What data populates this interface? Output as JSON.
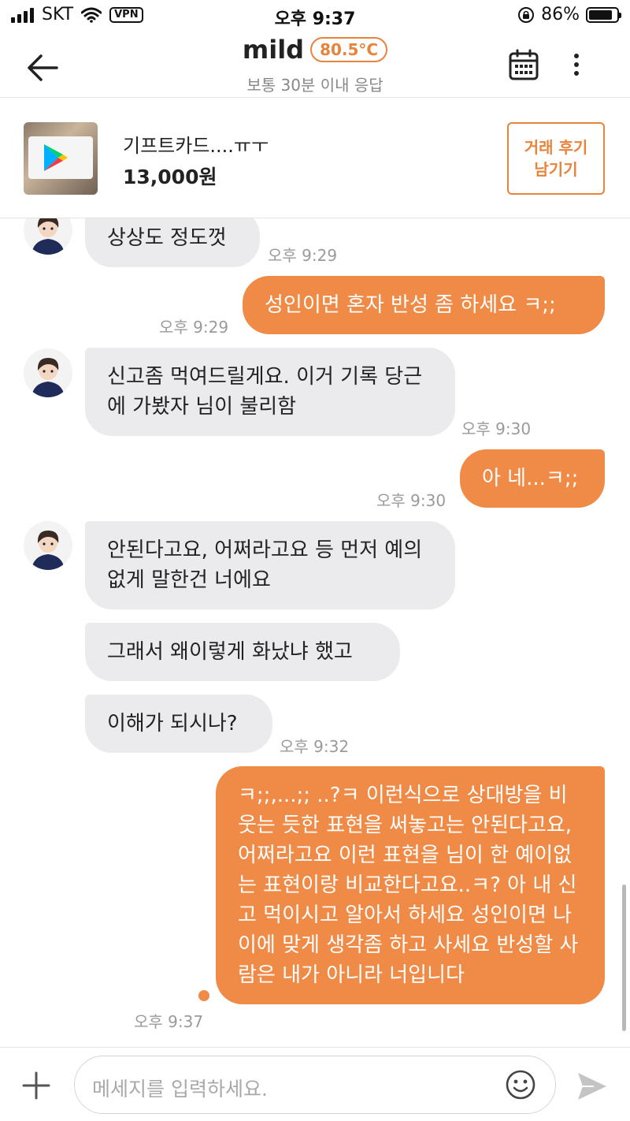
{
  "status_bar": {
    "carrier": "SKT",
    "vpn": "VPN",
    "time": "오후 9:37",
    "battery": "86%",
    "battery_level": 0.86
  },
  "header": {
    "user_name": "mild",
    "manner_temperature": "80.5°C",
    "response_time": "보통 30분 이내 응답",
    "icons": [
      "back-arrow-icon",
      "calendar-icon",
      "more-vertical-icon"
    ]
  },
  "product": {
    "title": "기프트카드....ㅠㅜ",
    "price": "13,000원",
    "review_button": "거래 후기 남기기"
  },
  "messages": [
    {
      "side": "in",
      "text": "상상도 정도껏",
      "time": "오후 9:29"
    },
    {
      "side": "out",
      "text": "성인이면 혼자 반성 좀 하세요 ㅋ;;",
      "time": "오후 9:29"
    },
    {
      "side": "in",
      "text": "신고좀 먹여드릴게요. 이거 기록 당근에 가봤자 님이 불리함",
      "time": "오후 9:30"
    },
    {
      "side": "out",
      "text": "아 네...ㅋ;;",
      "time": "오후 9:30"
    },
    {
      "side": "in",
      "text": "안된다고요, 어쩌라고요 등 먼저 예의없게 말한건 너에요",
      "time": ""
    },
    {
      "side": "in",
      "text": "그래서 왜이렇게 화났냐 했고",
      "time": ""
    },
    {
      "side": "in",
      "text": "이해가 되시나?",
      "time": "오후 9:32"
    },
    {
      "side": "out",
      "text": "ㅋ;;,...;; ..?ㅋ 이런식으로 상대방을 비웃는 듯한 표현을 써놓고는 안된다고요,어쩌라고요 이런 표현을 님이 한 예이없는 표현이랑 비교한다고요..ㅋ? 아 내 신고 먹이시고 알아서 하세요 성인이면 나이에 맞게 생각좀 하고 사세요 반성할 사람은 내가 아니라 너입니다",
      "time": "오후 9:37"
    }
  ],
  "input": {
    "placeholder": "메세지를 입력하세요."
  },
  "colors": {
    "accent": "#ef8b47",
    "incoming_bubble": "#ebebee",
    "muted_text": "#9a9a9a"
  }
}
